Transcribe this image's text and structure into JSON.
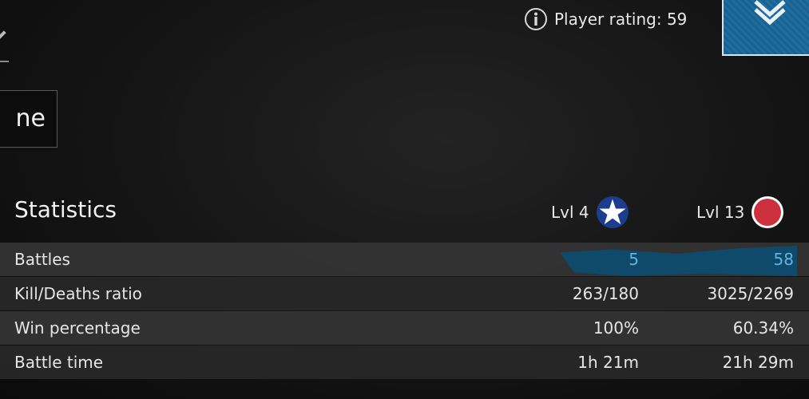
{
  "header": {
    "name_button_label": "ne",
    "player_rating_text": "Player rating: 59"
  },
  "statistics": {
    "title": "Statistics",
    "columns": [
      {
        "label": "Lvl 4",
        "icon": "us-star-roundel-icon",
        "color": "#1c3d8f"
      },
      {
        "label": "Lvl 13",
        "icon": "red-roundel-icon",
        "color": "#cc2f3d"
      }
    ],
    "rows": [
      {
        "label": "Battles",
        "values": [
          "5",
          "58"
        ],
        "highlighted": true
      },
      {
        "label": "Kill/Deaths ratio",
        "values": [
          "263/180",
          "3025/2269"
        ]
      },
      {
        "label": "Win percentage",
        "values": [
          "100%",
          "60.34%"
        ]
      },
      {
        "label": "Battle time",
        "values": [
          "1h 21m",
          "21h 29m"
        ]
      }
    ]
  },
  "colors": {
    "highlight_text": "#5fb3e6",
    "highlight_bar": "#0f4a6a",
    "rank_badge": "#1d6e9f"
  }
}
